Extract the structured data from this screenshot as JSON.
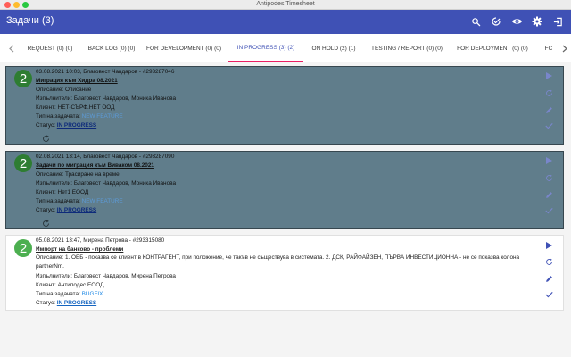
{
  "window": {
    "title": "Antipodes Timesheet"
  },
  "appbar": {
    "title": "Задачи (3)",
    "icons": [
      "search-icon",
      "check-circle-icon",
      "eye-icon",
      "gear-icon",
      "logout-icon"
    ]
  },
  "tabs": [
    {
      "label": "REQUEST (0) (0)"
    },
    {
      "label": "BACK LOG (0) (0)"
    },
    {
      "label": "FOR DEVELOPMENT (0) (0)"
    },
    {
      "label": "IN PROGRESS (3) (2)",
      "active": true
    },
    {
      "label": "ON HOLD (2) (1)"
    },
    {
      "label": "TESTING / REPORT (0) (0)"
    },
    {
      "label": "FOR DEPLOYMENT (0) (0)"
    },
    {
      "label": "FC"
    }
  ],
  "cards": [
    {
      "number": "2",
      "selected": true,
      "header": "03.08.2021 10:03, Благовест Чавдаров - #293287046",
      "title": "Миграция към Хидра 08.2021",
      "description": "Описание: Описание",
      "assignees": "Изпълнители: Благовест Чавдаров, Моника Иванова",
      "client": "Клиент: НЕТ-СЪРФ.НЕТ ООД",
      "type_label": "Тип на задачата: ",
      "type_value": "NEW FEATURE",
      "status_label": "Статус: ",
      "status_value": "IN PROGRESS"
    },
    {
      "number": "2",
      "selected": true,
      "header": "02.08.2021 13:14, Благовест Чавдаров - #293287090",
      "title": "Задачи по миграция към Виваком 08.2021",
      "description": "Описание: Трасиране на време",
      "assignees": "Изпълнители: Благовест Чавдаров, Моника Иванова",
      "client": "Клиент: Нет1 ЕООД",
      "type_label": "Тип на задачата: ",
      "type_value": "NEW FEATURE",
      "status_label": "Статус: ",
      "status_value": "IN PROGRESS"
    },
    {
      "number": "2",
      "selected": false,
      "header": "05.08.2021 13:47, Мирена Петрова - #293315080",
      "title": "Импорт на банково - проблеми",
      "description": "Описание: 1. ОББ - показва се клиент в КОНТРАГЕНТ, при положение, че такъв не съществува в системата. 2. ДСК, РАЙФАЙЗЕН, ПЪРВА ИНВЕСТИЦИОННА - не се показва колона partnerNm.",
      "assignees": "Изпълнители: Благовест Чавдаров, Мирена Петрова",
      "client": "Клиент: Антиподес ЕООД",
      "type_label": "Тип на задачата: ",
      "type_value": "BUGFIX",
      "status_label": "Статус: ",
      "status_value": "IN PROGRESS"
    }
  ],
  "colors": {
    "appbar": "#3f51b5",
    "tab_indicator": "#e91e63",
    "selected_card": "#607d8b",
    "badge": "#4caf50"
  }
}
